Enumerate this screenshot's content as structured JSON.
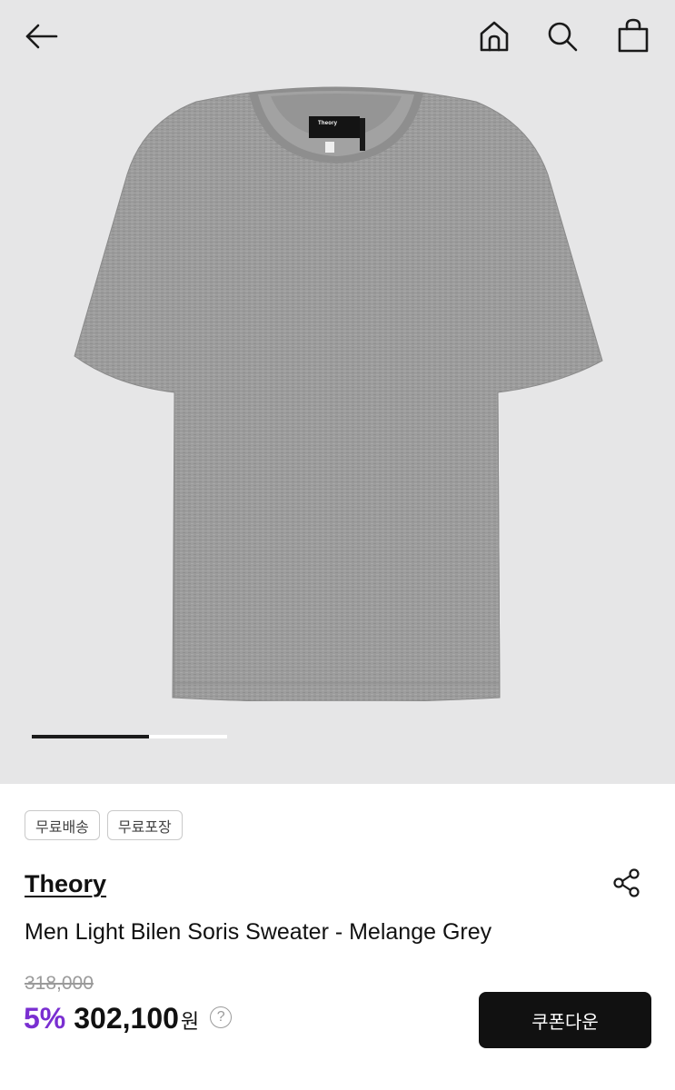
{
  "header": {
    "back_icon": "arrow-left-icon",
    "home_icon": "home-icon",
    "search_icon": "search-icon",
    "cart_icon": "shopping-bag-icon"
  },
  "gallery": {
    "label_brand_text": "Theory",
    "progress": 0.6
  },
  "badges": [
    "무료배송",
    "무료포장"
  ],
  "product": {
    "brand": "Theory",
    "name": "Men Light Bilen Soris Sweater - Melange Grey",
    "original_price": "318,000",
    "discount": "5%",
    "price": "302,100",
    "currency": "원",
    "help": "?"
  },
  "actions": {
    "share_icon": "share-icon",
    "coupon_label": "쿠폰다운"
  },
  "colors": {
    "hero_bg": "#e6e6e7",
    "discount": "#7a2fd1",
    "button_bg": "#111111"
  }
}
